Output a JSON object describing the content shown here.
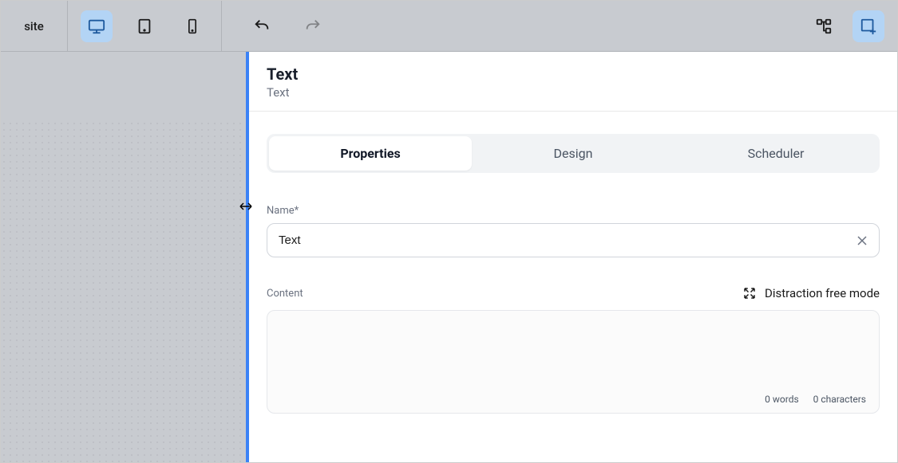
{
  "toolbar": {
    "site_label": "site"
  },
  "panel": {
    "title": "Text",
    "subtitle": "Text",
    "tabs": [
      {
        "label": "Properties",
        "active": true
      },
      {
        "label": "Design",
        "active": false
      },
      {
        "label": "Scheduler",
        "active": false
      }
    ],
    "name_field": {
      "label": "Name*",
      "value": "Text"
    },
    "content_field": {
      "label": "Content",
      "distraction_label": "Distraction free mode",
      "value": "",
      "words_label": "0 words",
      "chars_label": "0 characters"
    }
  }
}
